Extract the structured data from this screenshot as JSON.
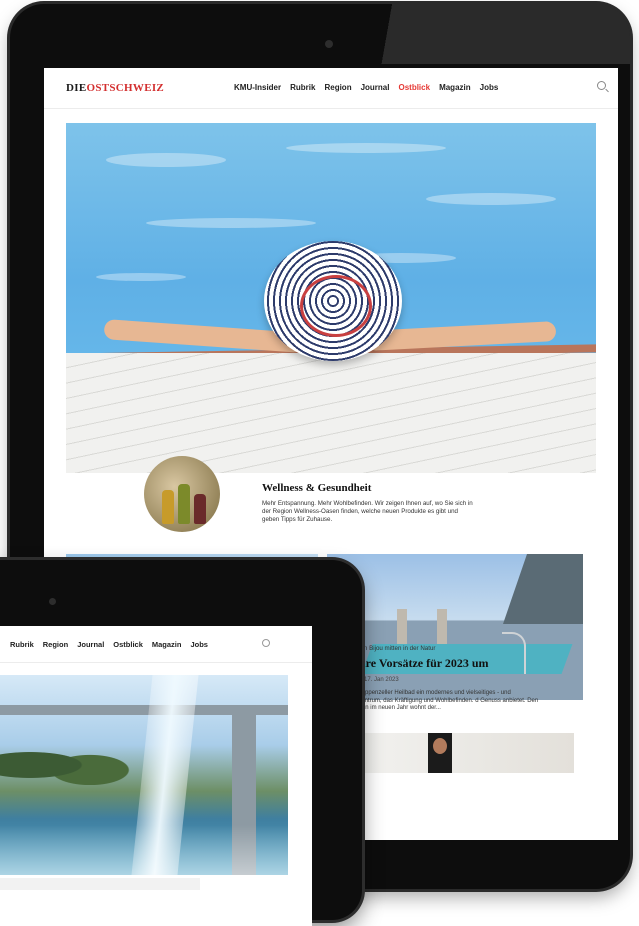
{
  "back_page": {
    "logo": {
      "die": "DIE",
      "ost": "OSTSCHWEIZ"
    },
    "nav": {
      "items": [
        "KMU-Insider",
        "Rubrik",
        "Region",
        "Journal",
        "Ostblick",
        "Magazin",
        "Jobs"
      ],
      "active": "Ostblick"
    },
    "feature": {
      "title": "Wellness & Gesundheit",
      "text": "Mehr Entspannung. Mehr Wohlbefinden. Wir zeigen Ihnen auf, wo Sie sich in der Region Wellness-Oasen finden, welche neuen Produkte es gibt und geben Tipps für Zuhause."
    },
    "card": {
      "meta": "Heilbad: Ein Bijou mitten in der Natur",
      "title": "zen Ihre Vorsätze für 2023 um",
      "date": "chweiz am 17. Jan 2023",
      "text": "en ist das Appenzeller Heilbad ein modernes und vielseitiges - und Wellnesszentrum, das Kräftigung und Wohlbefinden. d Genuss anbietet. Den ersten Tagen im neuen Jahr wohnt der..."
    }
  },
  "front_page": {
    "nav": {
      "items": [
        "Rubrik",
        "Region",
        "Journal",
        "Ostblick",
        "Magazin",
        "Jobs"
      ]
    }
  },
  "colors": {
    "accent": "#d32f2f",
    "text": "#111111"
  }
}
